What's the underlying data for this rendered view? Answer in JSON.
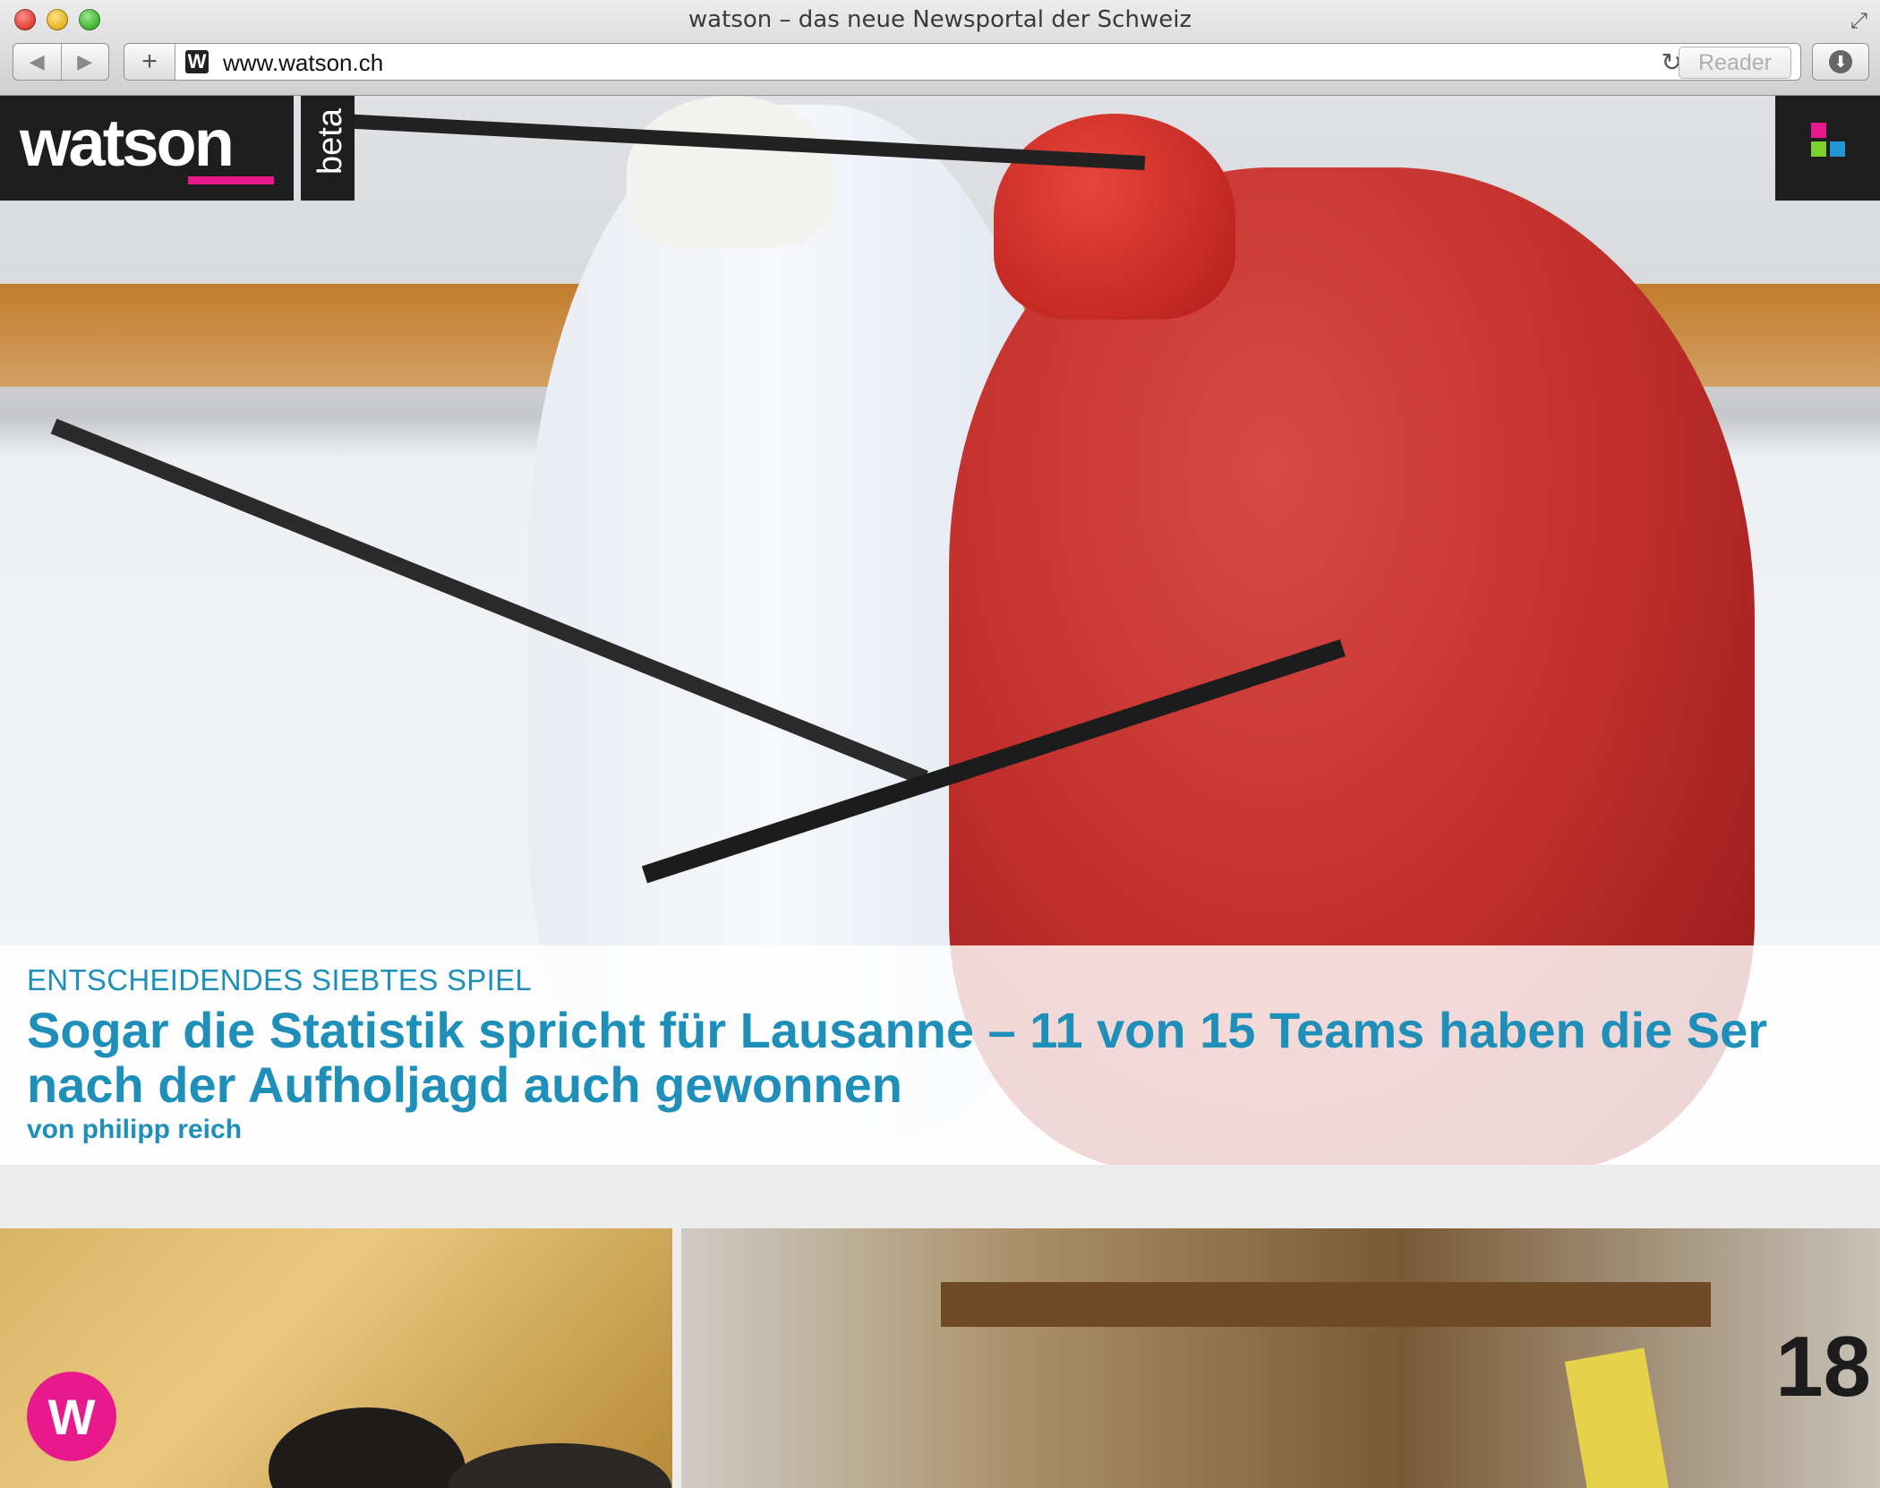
{
  "window": {
    "title": "watson – das neue Newsportal der Schweiz"
  },
  "toolbar": {
    "back_icon": "◀",
    "forward_icon": "▶",
    "new_tab_icon": "+",
    "favicon_letter": "W",
    "url": "www.watson.ch",
    "reload_icon": "↻",
    "reader_label": "Reader",
    "download_icon": "⬇",
    "resize_icon": "⤢"
  },
  "site": {
    "logo_text": "watson",
    "beta_label": "beta",
    "brand_color": "#e8198b",
    "menu_squares": [
      "#e8198b",
      "#7ad12c",
      "#2196d3",
      "#ffffff"
    ]
  },
  "hero": {
    "kicker": "ENTSCHEIDENDES SIEBTES SPIEL",
    "headline_line1": "Sogar die Statistik spricht für Lausanne – 11 von 15 Teams haben die Ser",
    "headline_line2": "nach der Aufholjagd auch gewonnen",
    "byline": "von philipp reich",
    "accent_color": "#1e8fb8"
  },
  "cards": {
    "number_text": "18",
    "badge_letter": "W"
  }
}
